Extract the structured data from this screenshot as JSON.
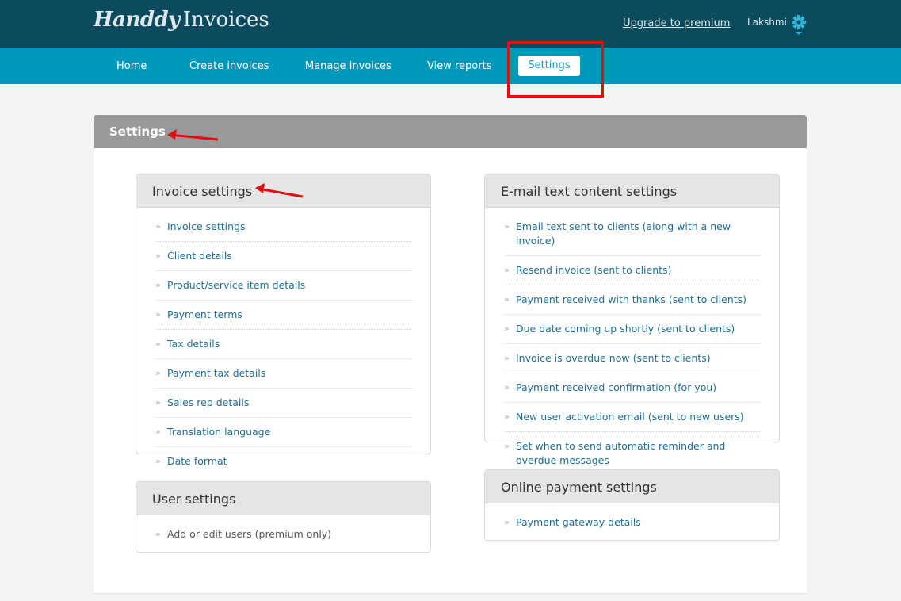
{
  "header": {
    "logo_script": "Handdy",
    "logo_rest": "Invoices",
    "upgrade_link": "Upgrade to premium",
    "user_name": "Lakshmi"
  },
  "nav": {
    "items": [
      "Home",
      "Create invoices",
      "Manage invoices",
      "View reports"
    ],
    "active": "Settings"
  },
  "main": {
    "title": "Settings"
  },
  "invoice_settings": {
    "title": "Invoice settings",
    "items": [
      "Invoice settings",
      "Client details",
      "Product/service item details",
      "Payment terms",
      "Tax details",
      "Payment tax details",
      "Sales rep details",
      "Translation language",
      "Date format"
    ]
  },
  "user_settings": {
    "title": "User settings",
    "items": [
      "Add or edit users (premium only)"
    ]
  },
  "email_settings": {
    "title": "E-mail text content settings",
    "items": [
      "Email text sent to clients (along with a new invoice)",
      "Resend invoice (sent to clients)",
      "Payment received with thanks (sent to clients)",
      "Due date coming up shortly (sent to clients)",
      "Invoice is overdue now (sent to clients)",
      "Payment received confirmation (for you)",
      "New user activation email (sent to new users)",
      "Set when to send automatic reminder and overdue messages"
    ]
  },
  "online_payment": {
    "title": "Online payment settings",
    "items": [
      "Payment gateway details"
    ]
  },
  "colors": {
    "header_bg": "#0c4a5e",
    "nav_bg": "#0099bb",
    "link": "#1d6d97",
    "annotation": "#e01010"
  }
}
